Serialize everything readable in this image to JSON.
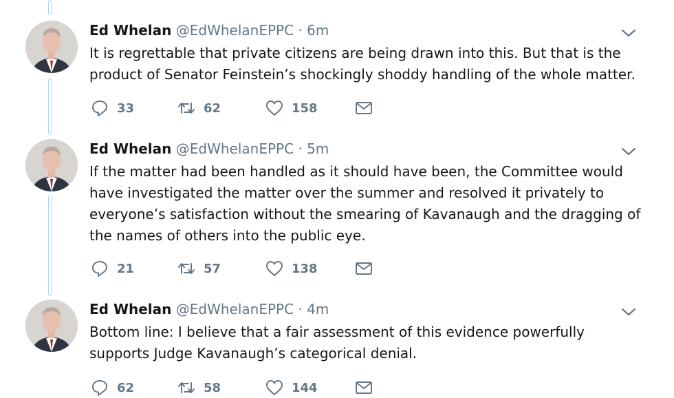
{
  "tweets": [
    {
      "name": "Ed Whelan",
      "handle": "@EdWhelanEPPC",
      "separator": "·",
      "time": "6m",
      "text": "It is regrettable that private citizens are being drawn into this. But that is the product of Senator Feinstein’s shockingly shoddy handling of the whole matter.",
      "replies": "33",
      "retweets": "62",
      "likes": "158"
    },
    {
      "name": "Ed Whelan",
      "handle": "@EdWhelanEPPC",
      "separator": "·",
      "time": "5m",
      "text": "If the matter had been handled as it should have been, the Committee would have investigated the matter over the summer and resolved it privately to everyone’s satisfaction without the smearing of Kavanaugh and the dragging of the names of others into the public eye.",
      "replies": "21",
      "retweets": "57",
      "likes": "138"
    },
    {
      "name": "Ed Whelan",
      "handle": "@EdWhelanEPPC",
      "separator": "·",
      "time": "4m",
      "text": "Bottom line: I believe that a fair assessment of this evidence powerfully supports Judge Kavanaugh’s categorical denial.",
      "replies": "62",
      "retweets": "58",
      "likes": "144"
    }
  ],
  "icons": {
    "reply": "reply-icon",
    "retweet": "retweet-icon",
    "like": "heart-icon",
    "dm": "envelope-icon",
    "more": "chevron-down-icon"
  },
  "colors": {
    "text": "#14171a",
    "secondary": "#657786",
    "thread_line": "#a9d4f2"
  }
}
